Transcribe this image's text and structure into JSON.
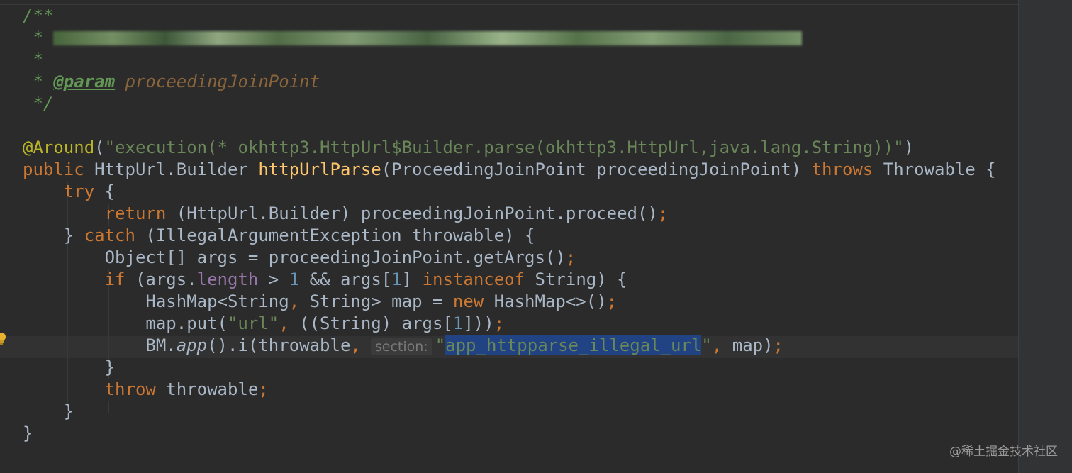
{
  "editor": {
    "blurred_line_text": "https://bugly.qq.com/v2/crash-reporting/...",
    "doc": {
      "open": "/**",
      "star": " *",
      "param_tag": "@param",
      "param_name": "proceedingJoinPoint",
      "close": " */"
    },
    "annotation": {
      "name": "@Around",
      "paren_open": "(",
      "value": "\"execution(* okhttp3.HttpUrl$Builder.parse(okhttp3.HttpUrl,java.lang.String))\"",
      "paren_close": ")"
    },
    "signature": {
      "modifier": "public",
      "return_type": " HttpUrl.Builder ",
      "method": "httpUrlParse",
      "params": "(ProceedingJoinPoint proceedingJoinPoint) ",
      "throws_kw": "throws",
      "throws_type": " Throwable {"
    },
    "try_line": {
      "indent": "    ",
      "kw": "try",
      "rest": " {"
    },
    "return_line": {
      "indent": "        ",
      "kw": "return",
      "rest": " (HttpUrl.Builder) proceedingJoinPoint.proceed()",
      "semi": ";"
    },
    "catch_line": {
      "indent": "    ",
      "before": "} ",
      "kw": "catch",
      "rest": " (IllegalArgumentException throwable) {"
    },
    "args_line": {
      "indent": "        ",
      "code": "Object[] args = proceedingJoinPoint.getArgs()",
      "semi": ";"
    },
    "if_line": {
      "indent": "        ",
      "kw": "if",
      "part1": " (args.",
      "field": "length",
      "part2": " > ",
      "num1": "1",
      "part3": " && args[",
      "num2": "1",
      "part4": "] ",
      "kw2": "instanceof",
      "part5": " String) {"
    },
    "map_decl_line": {
      "indent": "            ",
      "part1": "HashMap<String",
      "comma": ",",
      "part2": " String> map = ",
      "kw": "new",
      "part3": " HashMap<>()",
      "semi": ";"
    },
    "put_line": {
      "indent": "            ",
      "part1": "map.put(",
      "str": "\"url\"",
      "comma": ",",
      "part2": " ((String) args[",
      "num": "1",
      "part3": "]))",
      "semi": ";"
    },
    "bm_line": {
      "indent": "            ",
      "obj": "BM.",
      "method": "app",
      "part1": "().i(throwable",
      "comma": ",",
      "hint": "section:",
      "quote_open": "\"",
      "selected": "app_httpparse_illegal_url",
      "quote_close": "\"",
      "comma2": ",",
      "part2": " map)",
      "semi": ";"
    },
    "close_if": {
      "text": "        }"
    },
    "throw_line": {
      "indent": "        ",
      "kw": "throw",
      "rest": " throwable",
      "semi": ";"
    },
    "close_catch": {
      "text": "    }"
    },
    "close_method": {
      "text": "}"
    }
  },
  "watermark": "@稀土掘金技术社区",
  "colors": {
    "background": "#2b2b2b",
    "keyword": "#cc7832",
    "string": "#6a8759",
    "comment": "#629755",
    "annotation": "#bbb529",
    "method_decl": "#ffc66d",
    "number": "#6897bb",
    "field": "#9876aa",
    "selection": "#214283"
  },
  "icons": [
    "lightbulb-icon"
  ]
}
